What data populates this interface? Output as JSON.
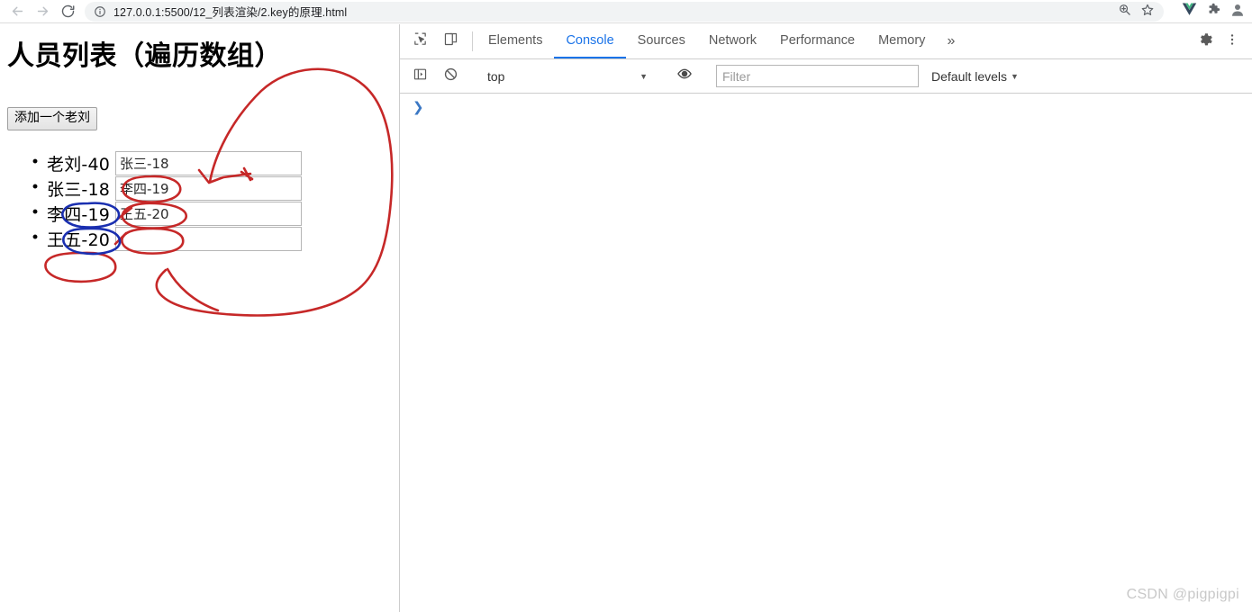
{
  "browser": {
    "back_icon": "arrow-left-icon",
    "forward_icon": "arrow-right-icon",
    "reload_icon": "reload-icon",
    "site_info_icon": "info-circle-icon",
    "url": "127.0.0.1:5500/12_列表渲染/2.key的原理.html",
    "zoom_icon": "zoom-magnifier-icon",
    "bookmark_icon": "star-icon",
    "vue_devtools_icon": "vue-logo-icon",
    "extensions_icon": "puzzle-piece-icon",
    "profile_icon": "profile-avatar-icon"
  },
  "page": {
    "title": "人员列表（遍历数组）",
    "add_button_label": "添加一个老刘",
    "people": [
      {
        "label": "老刘-40",
        "input_value": "张三-18"
      },
      {
        "label": "张三-18",
        "input_value": "李四-19"
      },
      {
        "label": "李四-19",
        "input_value": "王五-20"
      },
      {
        "label": "王五-20",
        "input_value": ""
      }
    ]
  },
  "annotations": {
    "ink_red": "#c62828",
    "ink_blue": "#1a2fb0",
    "marks": [
      {
        "name": "red-big-circle-around-inputs",
        "shape": "open-circle"
      },
      {
        "name": "red-arrow-to-first-input",
        "shape": "arrow"
      },
      {
        "name": "red-ellipse-input-1",
        "shape": "ellipse",
        "target": "张三-18"
      },
      {
        "name": "red-ellipse-input-2",
        "shape": "ellipse",
        "target": "李四-19"
      },
      {
        "name": "red-ellipse-input-3",
        "shape": "ellipse",
        "target": "王五-20"
      },
      {
        "name": "blue-ellipse-item-2",
        "shape": "ellipse",
        "target": "三-18"
      },
      {
        "name": "blue-ellipse-item-3",
        "shape": "ellipse",
        "target": "四-19"
      },
      {
        "name": "red-ellipse-item-4",
        "shape": "ellipse",
        "target": "王五-20"
      }
    ]
  },
  "devtools": {
    "inspect_icon": "inspect-element-icon",
    "device_toolbar_icon": "device-toolbar-icon",
    "tabs": [
      {
        "label": "Elements",
        "active": false
      },
      {
        "label": "Console",
        "active": true
      },
      {
        "label": "Sources",
        "active": false
      },
      {
        "label": "Network",
        "active": false
      },
      {
        "label": "Performance",
        "active": false
      },
      {
        "label": "Memory",
        "active": false
      }
    ],
    "more_tabs_label": "»",
    "settings_icon": "gear-icon",
    "menu_icon": "three-dots-vertical-icon",
    "console_toolbar": {
      "sidebar_toggle_icon": "console-sidebar-icon",
      "clear_console_icon": "clear-console-icon",
      "context_value": "top",
      "context_caret": "▼",
      "live_expression_icon": "eye-icon",
      "filter_placeholder": "Filter",
      "filter_value": "",
      "levels_label": "Default levels",
      "levels_caret": "▼"
    },
    "prompt_symbol": "❯"
  },
  "watermark": "CSDN @pigpigpi"
}
